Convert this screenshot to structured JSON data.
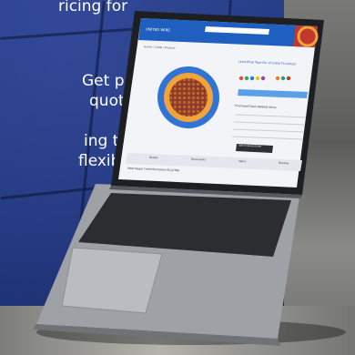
{
  "promo": {
    "line1": "ricing for",
    "line2": "Get pricing",
    "line3": "quotes",
    "line4": "ing to an",
    "line5": "flexibility"
  },
  "site": {
    "brand": "UNITED WIRE",
    "breadcrumb": "Home  /  Cable  /  Product",
    "product_title": "Lead Wrap Tape  No. of Cable  Tin plated",
    "order_label": "Purchase/Check Related Items",
    "add_button": "Add to Quote/Order",
    "tabs": [
      "Details",
      "Documents",
      "Specs",
      "Reviews"
    ],
    "bottom_label": "Meet Ragel  Cert/Information  6K JUTRA"
  },
  "colors": {
    "primary_blue": "#27408e",
    "site_blue": "#1f5fbf",
    "cable_orange": "#f2a33a",
    "cable_ring": "#2f74d6"
  }
}
